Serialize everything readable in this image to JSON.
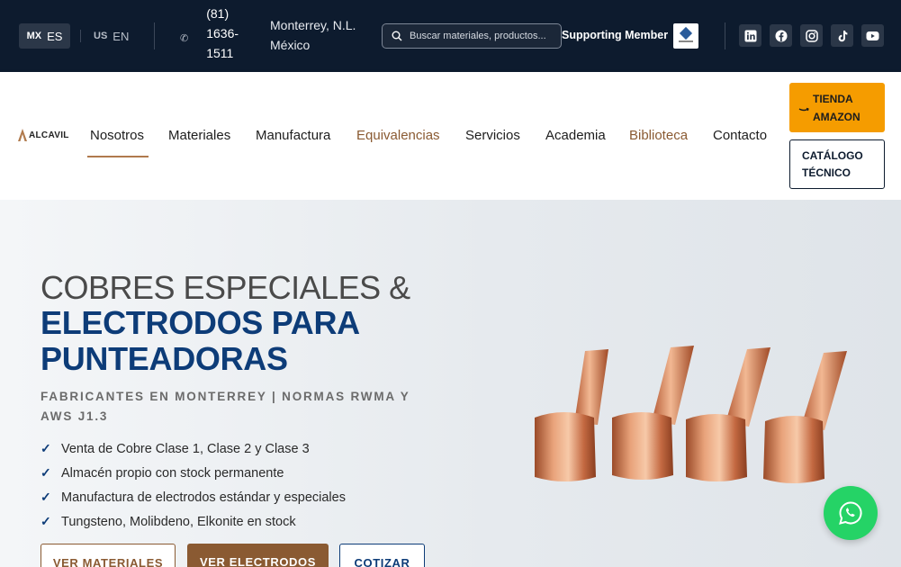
{
  "topbar": {
    "lang_mx": {
      "country": "MX",
      "label": "ES"
    },
    "lang_us": {
      "country": "US",
      "label": "EN"
    },
    "phone_lines": [
      "(81)",
      "1636-",
      "1511"
    ],
    "location_lines": [
      "Monterrey, N.L.",
      "México"
    ],
    "search_placeholder": "Buscar materiales, productos...",
    "member_label": "Supporting Member",
    "social_icons": [
      "linkedin-icon",
      "facebook-icon",
      "instagram-icon",
      "tiktok-icon",
      "youtube-icon"
    ]
  },
  "nav": {
    "logo_text": "ALCAVIL",
    "items": [
      "Nosotros",
      "Materiales",
      "Manufactura",
      "Equivalencias",
      "Servicios",
      "Academia",
      "Biblioteca",
      "Contacto"
    ],
    "amazon_lines": [
      "TIENDA",
      "AMAZON"
    ],
    "catalog_lines": [
      "CATÁLOGO",
      "TÉCNICO"
    ]
  },
  "hero": {
    "title_line1": "COBRES ESPECIALES &",
    "title_line2": "ELECTRODOS PARA PUNTEADORAS",
    "subtitle": "FABRICANTES EN MONTERREY | NORMAS RWMA Y AWS J1.3",
    "checks": [
      "Venta de Cobre Clase 1, Clase 2 y Clase 3",
      "Almacén propio con stock permanente",
      "Manufactura de electrodos estándar y especiales",
      "Tungsteno, Molibdeno, Elkonite en stock"
    ],
    "buttons": [
      "VER MATERIALES",
      "VER ELECTRODOS",
      "COTIZAR"
    ]
  },
  "colors": {
    "topbar_bg": "#0d1b2e",
    "accent_brown": "#8a5a32",
    "navy": "#0d3c78",
    "amazon_orange": "#f59c00",
    "whatsapp_green": "#25d366"
  }
}
